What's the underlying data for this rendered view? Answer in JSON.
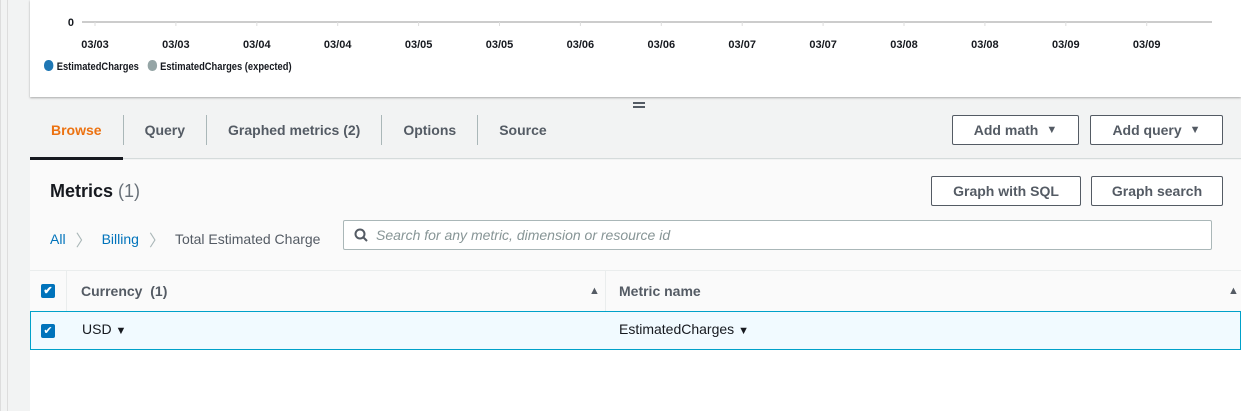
{
  "chart_data": {
    "type": "line",
    "y_ticks": [
      "0"
    ],
    "x_ticks": [
      "03/03",
      "03/03",
      "03/04",
      "03/04",
      "03/05",
      "03/05",
      "03/06",
      "03/06",
      "03/07",
      "03/07",
      "03/08",
      "03/08",
      "03/09",
      "03/09"
    ],
    "series": [
      {
        "name": "EstimatedCharges",
        "color": "#1f77b4",
        "values": []
      },
      {
        "name": "EstimatedCharges (expected)",
        "color": "#95a5a6",
        "values": []
      }
    ]
  },
  "tabs": [
    "Browse",
    "Query",
    "Graphed metrics (2)",
    "Options",
    "Source"
  ],
  "buttons": {
    "add_math": "Add math",
    "add_query": "Add query",
    "graph_sql": "Graph with SQL",
    "graph_search": "Graph search"
  },
  "metrics": {
    "title": "Metrics",
    "count": "(1)"
  },
  "breadcrumb": {
    "all": "All",
    "billing": "Billing",
    "current": "Total Estimated Charge"
  },
  "search": {
    "placeholder": "Search for any metric, dimension or resource id"
  },
  "table": {
    "col1": "Currency",
    "col1_count": "(1)",
    "col2": "Metric name",
    "rows": [
      {
        "currency": "USD",
        "metric": "EstimatedCharges"
      }
    ]
  }
}
